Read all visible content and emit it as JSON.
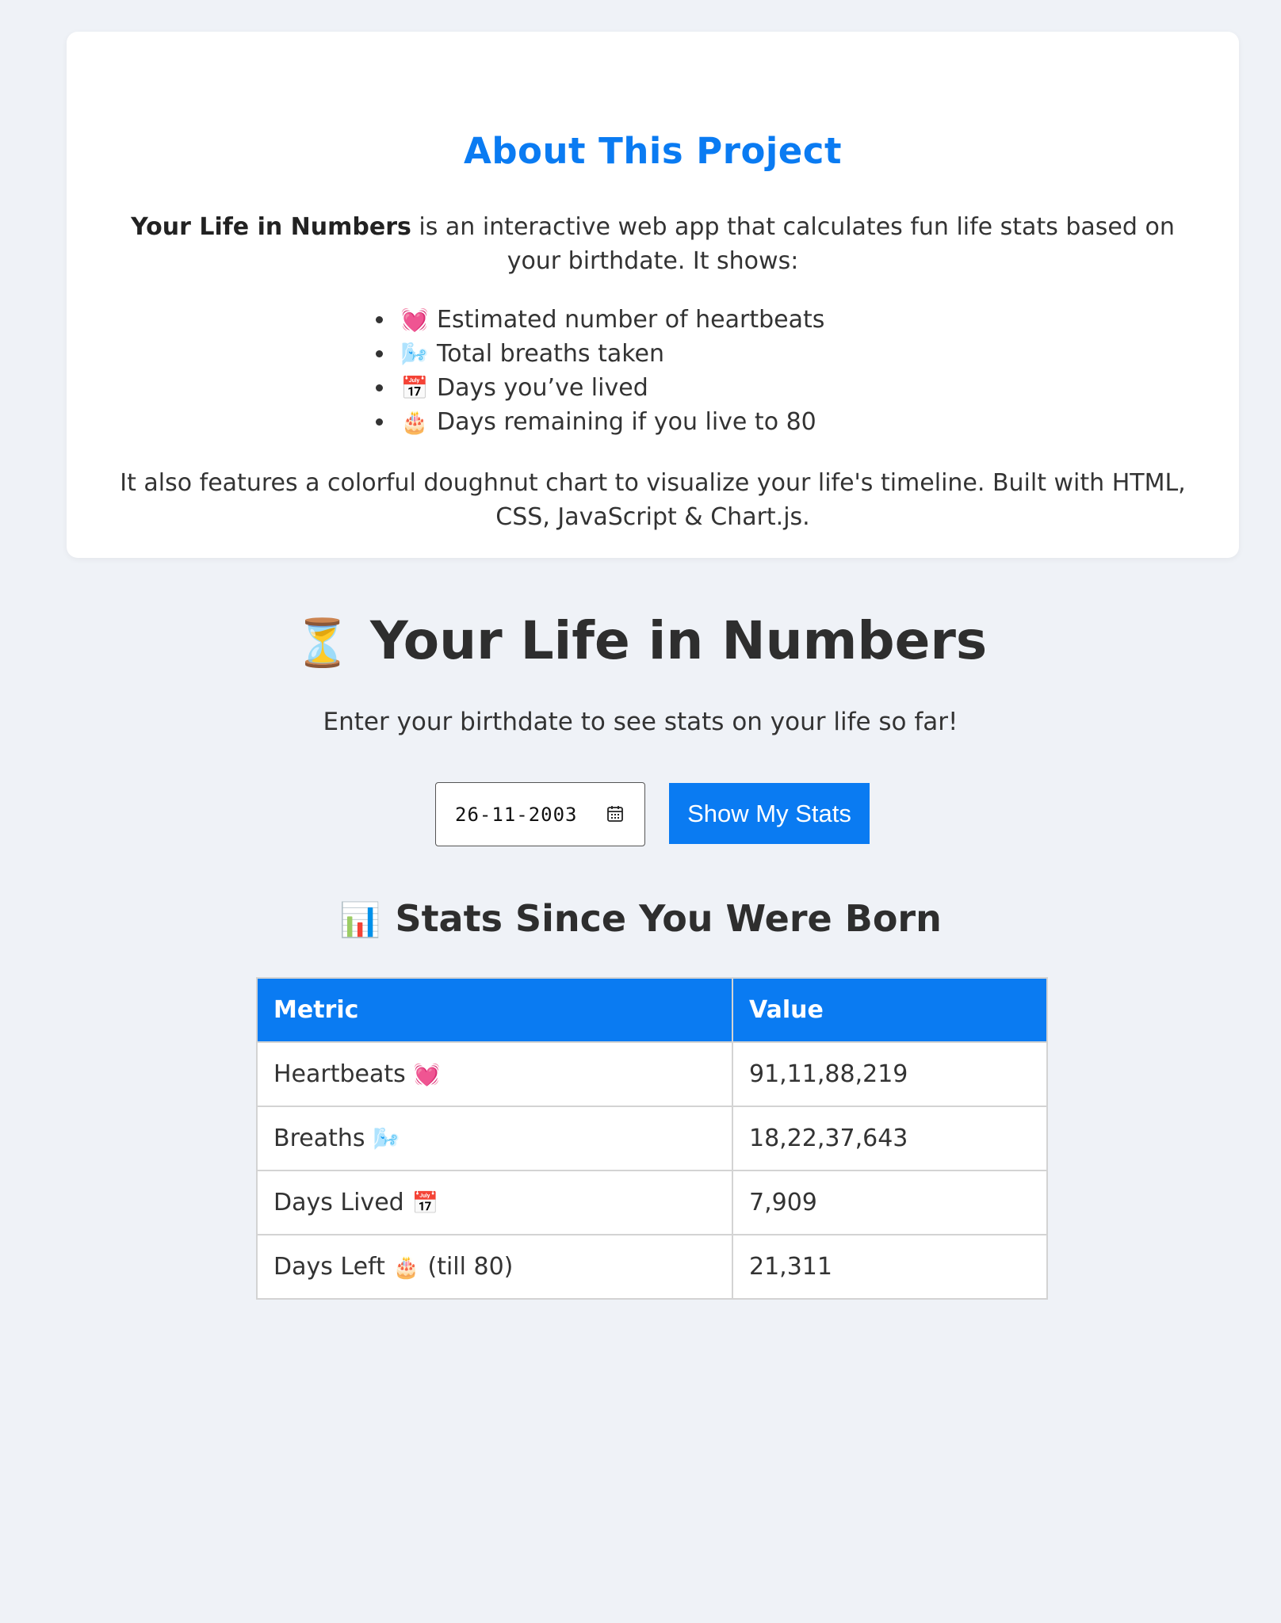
{
  "about": {
    "title": "About This Project",
    "intro_bold": "Your Life in Numbers",
    "intro_rest": " is an interactive web app that calculates fun life stats based on your birthdate. It shows:",
    "features": [
      {
        "emoji": "💓",
        "icon": "heart-icon",
        "text": "Estimated number of heartbeats"
      },
      {
        "emoji": "🌬️",
        "icon": "breath-icon",
        "text": "Total breaths taken"
      },
      {
        "emoji": "📅",
        "icon": "calendar-icon",
        "text": "Days you’ve lived"
      },
      {
        "emoji": "🎂",
        "icon": "cake-icon",
        "text": "Days remaining if you live to 80"
      }
    ],
    "outro": "It also features a colorful doughnut chart to visualize your life's timeline. Built with HTML, CSS, JavaScript & Chart.js."
  },
  "app": {
    "title_emoji": "⏳",
    "title": "Your Life in Numbers",
    "subtitle": "Enter your birthdate to see stats on your life so far!",
    "date_value": "26-11-2003",
    "button_label": "Show My Stats"
  },
  "stats": {
    "title_emoji": "📊",
    "title": "Stats Since You Were Born",
    "headers": [
      "Metric",
      "Value"
    ],
    "rows": [
      {
        "metric": "Heartbeats",
        "emoji": "💓",
        "suffix": "",
        "value": "91,11,88,219"
      },
      {
        "metric": "Breaths",
        "emoji": "🌬️",
        "suffix": "",
        "value": "18,22,37,643"
      },
      {
        "metric": "Days Lived",
        "emoji": "📅",
        "suffix": "",
        "value": "7,909"
      },
      {
        "metric": "Days Left",
        "emoji": "🎂",
        "suffix": "(till 80)",
        "value": "21,311"
      }
    ]
  },
  "colors": {
    "accent": "#0a7bf2",
    "background": "#eff2f7",
    "card": "#ffffff"
  }
}
